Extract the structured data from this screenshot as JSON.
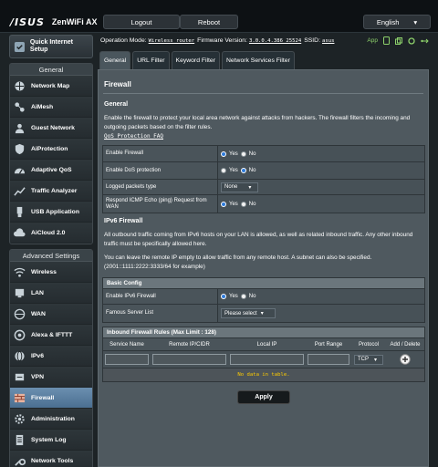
{
  "header": {
    "brand": "/ISUS",
    "model": "ZenWiFi AX",
    "logout": "Logout",
    "reboot": "Reboot",
    "language": "English"
  },
  "status": {
    "op_mode_label": "Operation Mode:",
    "op_mode_value": "Wireless router",
    "firmware_label": "Firmware Version:",
    "firmware_value": "3.0.0.4.386_25524",
    "ssid_label": "SSID:",
    "ssid_value": "asus",
    "app_label": "App"
  },
  "sidebar": {
    "quick_setup": "Quick Internet Setup",
    "general_title": "General",
    "general_items": [
      "Network Map",
      "AiMesh",
      "Guest Network",
      "AiProtection",
      "Adaptive QoS",
      "Traffic Analyzer",
      "USB Application",
      "AiCloud 2.0"
    ],
    "advanced_title": "Advanced Settings",
    "advanced_items": [
      "Wireless",
      "LAN",
      "WAN",
      "Alexa & IFTTT",
      "IPv6",
      "VPN",
      "Firewall",
      "Administration",
      "System Log",
      "Network Tools"
    ]
  },
  "tabs": [
    "General",
    "URL Filter",
    "Keyword Filter",
    "Network Services Filter"
  ],
  "firewall": {
    "title": "Firewall",
    "section_general": "General",
    "general_desc": "Enable the firewall to protect your local area network against attacks from hackers. The firewall filters the incoming and outgoing packets based on the filter rules.",
    "qos_faq": "QoS Protection FAQ",
    "rows": {
      "enable_firewall": "Enable Firewall",
      "enable_dos": "Enable DoS protection",
      "logged_packets": "Logged packets type",
      "logged_value": "None",
      "icmp": "Respond ICMP Echo (ping) Request from WAN"
    },
    "yes": "Yes",
    "no": "No",
    "ipv6_title": "IPv6 Firewall",
    "ipv6_desc1": "All outbound traffic coming from IPv6 hosts on your LAN is allowed, as well as related inbound traffic. Any other inbound traffic must be specifically allowed here.",
    "ipv6_desc2": "You can leave the remote IP empty to allow traffic from any remote host. A subnet can also be specified. (2001::1111:2222:3333/64 for example)",
    "basic_config": "Basic Config",
    "enable_ipv6_fw": "Enable IPv6 Firewall",
    "famous_server": "Famous Server List",
    "famous_placeholder": "Please select",
    "inbound_title": "Inbound Firewall Rules (Max Limit : 128)",
    "columns": [
      "Service Name",
      "Remote IP/CIDR",
      "Local IP",
      "Port Range",
      "Protocol",
      "Add / Delete"
    ],
    "protocol_value": "TCP",
    "no_data": "No data in table.",
    "apply": "Apply"
  }
}
